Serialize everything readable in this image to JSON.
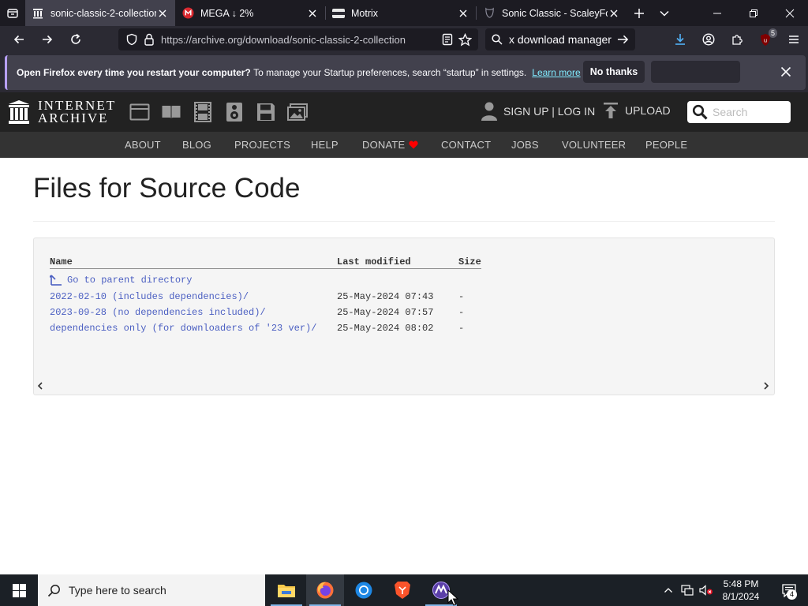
{
  "browser": {
    "tabs": [
      {
        "title": "sonic-classic-2-collection",
        "icon": "internet-archive-icon",
        "active": true
      },
      {
        "title": "MEGA ↓ 2%",
        "icon": "mega-icon",
        "active": false
      },
      {
        "title": "Motrix",
        "icon": "motrix-icon",
        "active": false
      },
      {
        "title": "Sonic Classic - ScaleyFoxy",
        "icon": "website-icon",
        "active": false
      }
    ],
    "url": "https://archive.org/download/sonic-classic-2-collection",
    "search_value": "x download manager",
    "extension_badge": "5"
  },
  "notification": {
    "bold_text": "Open Firefox every time you restart your computer?",
    "text": "To manage your Startup preferences, search “startup” in settings.",
    "learn_more": "Learn more",
    "no_thanks": "No thanks"
  },
  "ia": {
    "logo_line1": "INTERNET",
    "logo_line2": "ARCHIVE",
    "signup": "SIGN UP | LOG IN",
    "upload": "UPLOAD",
    "search_placeholder": "Search",
    "nav": [
      "ABOUT",
      "BLOG",
      "PROJECTS",
      "HELP",
      "DONATE",
      "CONTACT",
      "JOBS",
      "VOLUNTEER",
      "PEOPLE"
    ],
    "accent": "#ff0000"
  },
  "page": {
    "title": "Files for Source Code",
    "columns": [
      "Name",
      "Last modified",
      "Size"
    ],
    "parent": "Go to parent directory",
    "rows": [
      {
        "name": "2022-02-10 (includes dependencies)/",
        "modified": "25-May-2024 07:43",
        "size": "-"
      },
      {
        "name": "2023-09-28 (no dependencies included)/",
        "modified": "25-May-2024 07:57",
        "size": "-"
      },
      {
        "name": "dependencies only (for downloaders of '23 ver)/",
        "modified": "25-May-2024 08:02",
        "size": "-"
      }
    ]
  },
  "taskbar": {
    "search_placeholder": "Type here to search",
    "time": "5:48 PM",
    "date": "8/1/2024",
    "notification_count": "4"
  }
}
